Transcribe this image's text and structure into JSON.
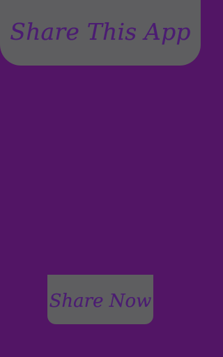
{
  "header": {
    "title": "Share This App"
  },
  "actions": {
    "share_label": "Share Now"
  },
  "colors": {
    "background": "#521565",
    "panel": "#5e5e60",
    "text": "#4b1c72"
  }
}
